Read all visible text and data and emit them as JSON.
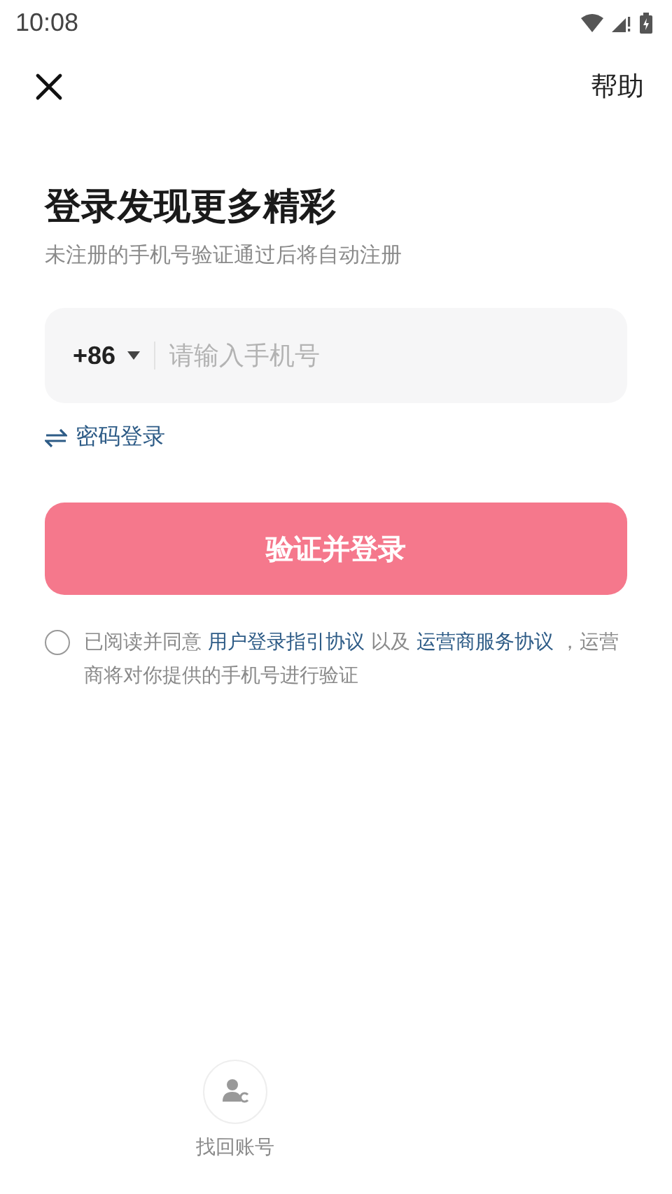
{
  "status_bar": {
    "time": "10:08"
  },
  "top_bar": {
    "help": "帮助"
  },
  "title": "登录发现更多精彩",
  "subtitle": "未注册的手机号验证通过后将自动注册",
  "phone_field": {
    "country_code": "+86",
    "placeholder": "请输入手机号"
  },
  "password_login": "密码登录",
  "submit_button": "验证并登录",
  "agreement": {
    "checked": false,
    "parts": [
      {
        "kind": "text",
        "text": "已阅读并同意 "
      },
      {
        "kind": "link",
        "text": "用户登录指引协议"
      },
      {
        "kind": "text",
        "text": " 以及 "
      },
      {
        "kind": "link",
        "text": "运营商服务协议"
      },
      {
        "kind": "text",
        "text": " ，运营商将对你提供的手机号进行验证"
      }
    ]
  },
  "bottom_options": [
    {
      "label": "找回账号"
    }
  ]
}
